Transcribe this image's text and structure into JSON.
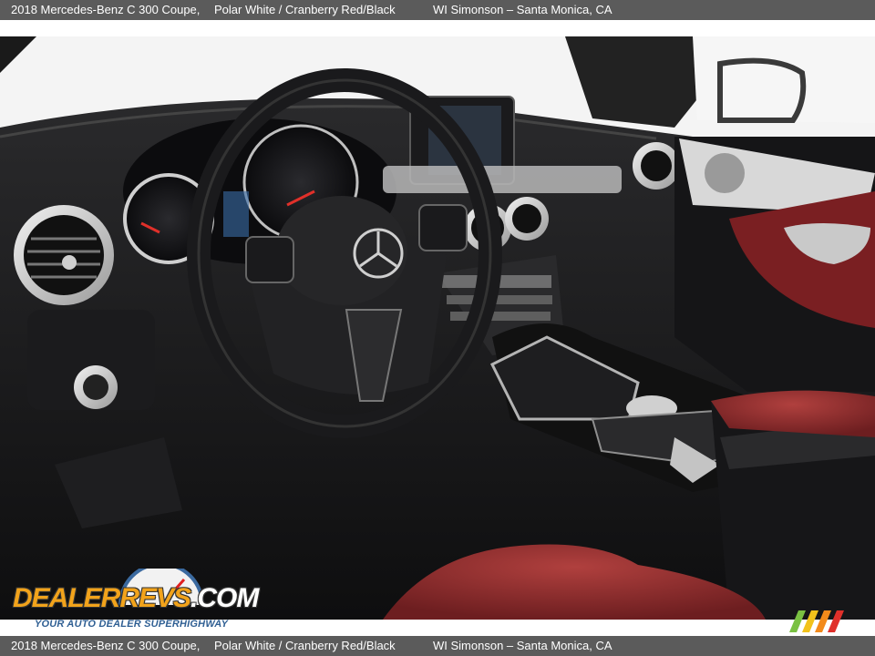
{
  "header": {
    "title": "2018 Mercedes-Benz C 300 Coupe,",
    "color": "Polar White / Cranberry Red/Black",
    "dealer": "WI Simonson – Santa Monica, CA"
  },
  "footer": {
    "title": "2018 Mercedes-Benz C 300 Coupe,",
    "color": "Polar White / Cranberry Red/Black",
    "dealer": "WI Simonson – Santa Monica, CA"
  },
  "watermark": {
    "brand": "DEALERREVS.COM",
    "brand_main": "DEALERREVS",
    "brand_suffix": ".COM",
    "tagline": "YOUR AUTO DEALER SUPERHIGHWAY"
  },
  "colors": {
    "bar": "#5b5b5b",
    "upholstery": "#8e2a2c",
    "dash": "#1b1b1d",
    "logo_orange": "#f2a31b",
    "logo_blue": "#2f5f93"
  }
}
